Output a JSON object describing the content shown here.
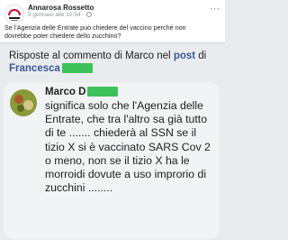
{
  "post": {
    "author": "Annarosa Rossetto",
    "timestamp": "9 gennaio alle 10:54",
    "separator": "·",
    "privacy_icon": "globe-icon",
    "text": "Se l'Agenzia delle Entrate può chiedere del vaccino perché non dovrebbe poter chiedere dello zucchino?",
    "more_icon": "ellipsis-icon"
  },
  "reply_heading": {
    "prefix": "Risposte al commento di Marco nel ",
    "post_link": "post",
    "middle": " di ",
    "author_link": "Francesca",
    "redaction_color": "#3ec15a"
  },
  "comment": {
    "author_first_name": "Marco",
    "author_last_initial": "D",
    "text": "significa solo che l'Agenzia delle Entrate, che tra l'altro sa già tutto di te ....... chiederà al SSN se il tizio X si è vaccinato SARS Cov 2 o meno, non se il tizio X ha le morroidi dovute a uso improrio di zucchini ........"
  },
  "colors": {
    "link": "#385898",
    "redaction": "#3ec15a",
    "bubble": "#f2f3f5",
    "text": "#1c1e21",
    "meta": "#90949c"
  }
}
